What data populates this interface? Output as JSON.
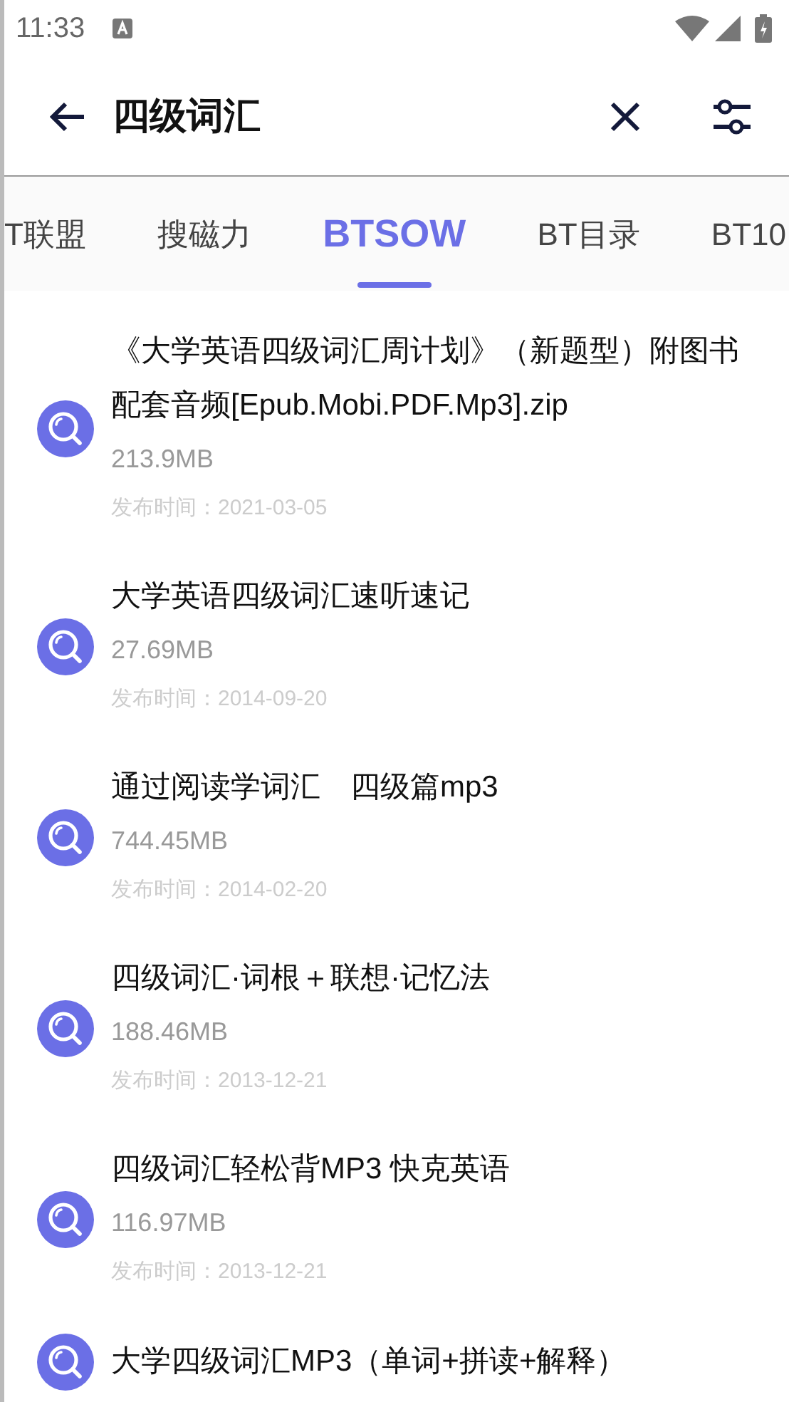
{
  "status_bar": {
    "time": "11:33"
  },
  "search": {
    "query": "四级词汇"
  },
  "tabs": [
    {
      "label": "T联盟",
      "selected": false
    },
    {
      "label": "搜磁力",
      "selected": false
    },
    {
      "label": "BTSOW",
      "selected": true
    },
    {
      "label": "BT目录",
      "selected": false
    },
    {
      "label": "BT10",
      "selected": false
    }
  ],
  "results": [
    {
      "title": "《大学英语四级词汇周计划》（新题型）附图书配套音频[Epub.Mobi.PDF.Mp3].zip",
      "size": "213.9MB",
      "date": "发布时间：2021-03-05"
    },
    {
      "title": "大学英语四级词汇速听速记",
      "size": "27.69MB",
      "date": "发布时间：2014-09-20"
    },
    {
      "title": "通过阅读学词汇　四级篇mp3",
      "size": "744.45MB",
      "date": "发布时间：2014-02-20"
    },
    {
      "title": "四级词汇·词根＋联想·记忆法",
      "size": "188.46MB",
      "date": "发布时间：2013-12-21"
    },
    {
      "title": "四级词汇轻松背MP3 快克英语",
      "size": "116.97MB",
      "date": "发布时间：2013-12-21"
    },
    {
      "title": "大学四级词汇MP3（单词+拼读+解释）"
    }
  ]
}
